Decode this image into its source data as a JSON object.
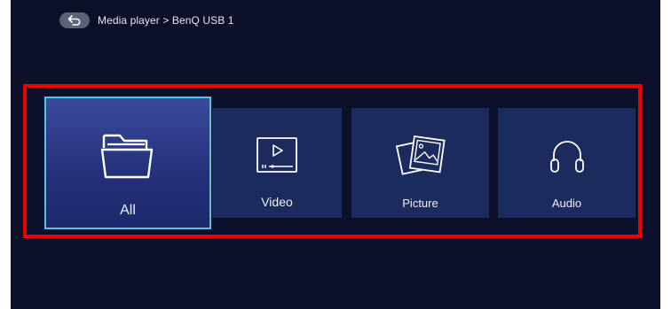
{
  "breadcrumb": {
    "back_icon": "back-arrow-icon",
    "path": "Media player > BenQ USB 1"
  },
  "categories": [
    {
      "label": "All",
      "icon": "folder-icon",
      "selected": true
    },
    {
      "label": "Video",
      "icon": "video-player-icon",
      "selected": false
    },
    {
      "label": "Picture",
      "icon": "pictures-icon",
      "selected": false
    },
    {
      "label": "Audio",
      "icon": "headphones-icon",
      "selected": false
    }
  ],
  "colors": {
    "screen_background": "#0c1129",
    "tile_background": "#1b2b5e",
    "selected_border": "#4fc3e8",
    "annotation_box": "#ee0000"
  }
}
